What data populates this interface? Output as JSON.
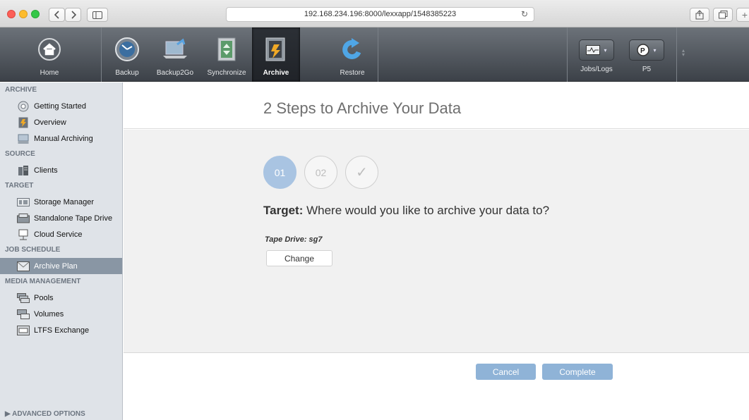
{
  "browser": {
    "url": "192.168.234.196:8000/lexxapp/1548385223"
  },
  "toolbar": {
    "tools": [
      {
        "label": "Home",
        "icon": "home-icon"
      },
      {
        "label": "Backup",
        "icon": "backup-clock-icon"
      },
      {
        "label": "Backup2Go",
        "icon": "laptop-icon"
      },
      {
        "label": "Synchronize",
        "icon": "synchronize-icon"
      },
      {
        "label": "Archive",
        "icon": "archive-vault-icon",
        "active": true
      },
      {
        "label": "Restore",
        "icon": "restore-arrow-icon"
      }
    ],
    "right": [
      {
        "label": "Jobs/Logs",
        "icon": "monitor-icon"
      },
      {
        "label": "P5",
        "icon": "p5-logo-icon"
      }
    ]
  },
  "sidebar": {
    "sections": [
      {
        "title": "ARCHIVE",
        "items": [
          "Getting Started",
          "Overview",
          "Manual Archiving"
        ]
      },
      {
        "title": "SOURCE",
        "items": [
          "Clients"
        ]
      },
      {
        "title": "TARGET",
        "items": [
          "Storage Manager",
          "Standalone Tape Drive",
          "Cloud Service"
        ]
      },
      {
        "title": "JOB SCHEDULE",
        "items": [
          "Archive Plan"
        ]
      },
      {
        "title": "MEDIA MANAGEMENT",
        "items": [
          "Pools",
          "Volumes",
          "LTFS Exchange"
        ]
      }
    ],
    "selected": "Archive Plan",
    "advanced": "ADVANCED OPTIONS"
  },
  "main": {
    "title": "2 Steps to Archive Your Data",
    "steps": [
      "01",
      "02",
      "✓"
    ],
    "active_step": "01",
    "question_label": "Target:",
    "question_text": "Where would you like to archive your data to?",
    "tape_drive": "Tape Drive: sg7",
    "change_label": "Change",
    "cancel_label": "Cancel",
    "complete_label": "Complete"
  },
  "colors": {
    "accent": "#8fb3d7",
    "active_step": "#a9c4e2",
    "sidebar_bg": "#dfe3e8",
    "selected_item": "#8996a4"
  }
}
